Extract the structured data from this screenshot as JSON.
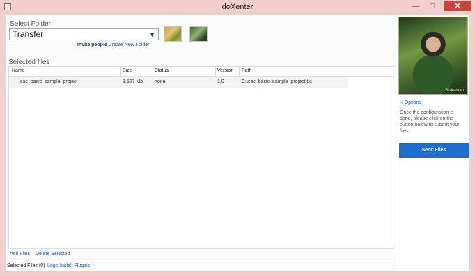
{
  "window": {
    "title": "doXenter",
    "minimize_glyph": "—",
    "maximize_glyph": "□",
    "close_glyph": "✕"
  },
  "folder": {
    "label": "Select Folder",
    "selected": "Transfer",
    "links": {
      "invite": "Invite people",
      "create": "Create New Folder"
    }
  },
  "files": {
    "label": "Selected files",
    "columns": [
      "Name",
      "Size",
      "Status",
      "Version",
      "Path"
    ],
    "rows": [
      {
        "name": "sac_basic_sample_project",
        "size": "3.527 Mb",
        "status": "none",
        "version": "1.0",
        "path": "C:\\sac_basic_sample_project.txt"
      }
    ]
  },
  "actions": {
    "add": "Add Files",
    "delete": "Delete Selected"
  },
  "status": {
    "selected_count": "Selected Files (0)",
    "logs": "Logs",
    "plugins": "Install Plugins"
  },
  "side": {
    "avatar_caption": "Shikamaru",
    "options": "» Options",
    "instructions": "Once the configuration is done, please click on the button below to submit your files.",
    "send_button": "Send Files"
  },
  "colors": {
    "accent": "#1c6fd0",
    "link": "#1a5fb4",
    "window_frame": "#f2cfcb",
    "close_button": "#c9453a"
  }
}
